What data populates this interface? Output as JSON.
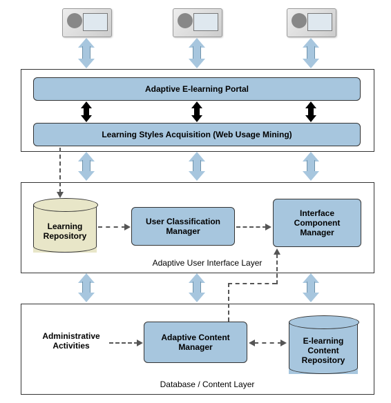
{
  "users": [
    "user-1",
    "user-2",
    "user-3"
  ],
  "presentation_layer": {
    "portal": "Adaptive E-learning Portal",
    "acquisition": "Learning Styles Acquisition (Web Usage Mining)"
  },
  "ui_layer": {
    "caption": "Adaptive User Interface Layer",
    "learning_repo": "Learning\nRepository",
    "user_class_mgr": "User Classification\nManager",
    "interface_comp_mgr": "Interface\nComponent\nManager"
  },
  "content_layer": {
    "caption": "Database / Content Layer",
    "admin": "Administrative\nActivities",
    "adaptive_mgr": "Adaptive Content\nManager",
    "elearning_repo": "E-learning\nContent\nRepository"
  },
  "colors": {
    "component": "#a7c6de",
    "cylinder_beige": "#e8e6c8",
    "border": "#333333"
  }
}
